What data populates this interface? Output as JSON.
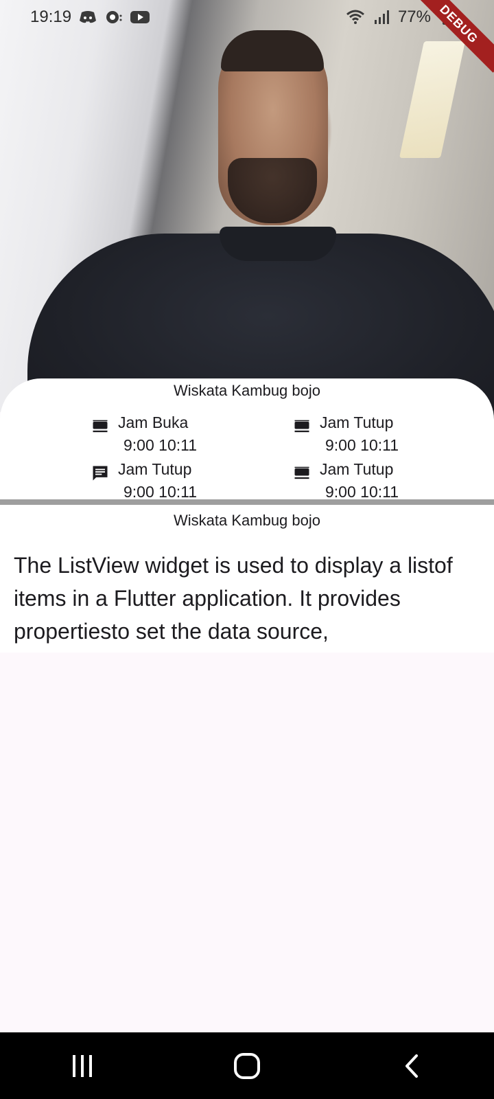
{
  "status_bar": {
    "time": "19:19",
    "battery": "77%",
    "icons_left": [
      "discord-icon",
      "chat-bubble-icon",
      "youtube-icon"
    ],
    "icons_right": [
      "wifi-icon",
      "signal-icon",
      "battery-icon"
    ]
  },
  "debug_banner": "DEBUG",
  "header_image": {
    "description_icon": "profile-photo"
  },
  "info_card": {
    "title": "Wiskata Kambug bojo",
    "items": [
      {
        "icon": "dock-icon",
        "label": "Jam Buka",
        "time": "9:00 10:11"
      },
      {
        "icon": "dock-icon",
        "label": "Jam Tutup",
        "time": "9:00 10:11"
      },
      {
        "icon": "message-icon",
        "label": "Jam Tutup",
        "time": "9:00 10:11"
      },
      {
        "icon": "dock-icon",
        "label": "Jam Tutup",
        "time": "9:00 10:11"
      }
    ]
  },
  "description": {
    "title": "Wiskata Kambug bojo",
    "text": "The ListView widget is used to display a listof items in a Flutter application. It provides propertiesto set the data source,"
  },
  "nav_bar": {
    "buttons": [
      "recent-apps-icon",
      "home-icon",
      "back-icon"
    ]
  }
}
